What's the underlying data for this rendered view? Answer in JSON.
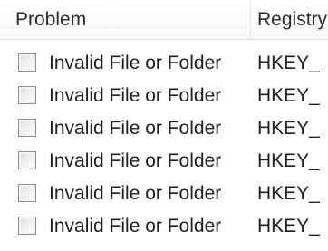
{
  "table": {
    "columns": [
      {
        "label": "Problem"
      },
      {
        "label": "Registry"
      }
    ],
    "rows": [
      {
        "checked": false,
        "problem": "Invalid File or Folder",
        "registry": "HKEY_"
      },
      {
        "checked": false,
        "problem": "Invalid File or Folder",
        "registry": "HKEY_"
      },
      {
        "checked": false,
        "problem": "Invalid File or Folder",
        "registry": "HKEY_"
      },
      {
        "checked": false,
        "problem": "Invalid File or Folder",
        "registry": "HKEY_"
      },
      {
        "checked": false,
        "problem": "Invalid File or Folder",
        "registry": "HKEY_"
      },
      {
        "checked": false,
        "problem": "Invalid File or Folder",
        "registry": "HKEY_"
      }
    ]
  }
}
